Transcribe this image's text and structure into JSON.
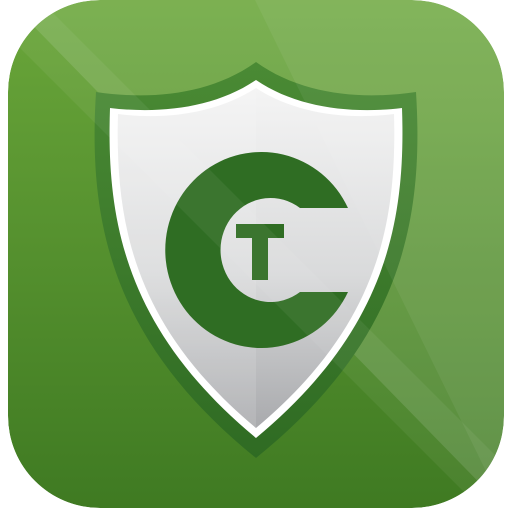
{
  "app_icon": {
    "name": "shield-app-icon",
    "logo_letters": "CT",
    "colors": {
      "background_top": "#6aa63a",
      "background_bottom": "#3f7a22",
      "shield_outline": "#3d7a2c",
      "shield_inner_top": "#f2f2f2",
      "shield_inner_bottom": "#a9aaad",
      "letter_green": "#2f6d23"
    }
  }
}
